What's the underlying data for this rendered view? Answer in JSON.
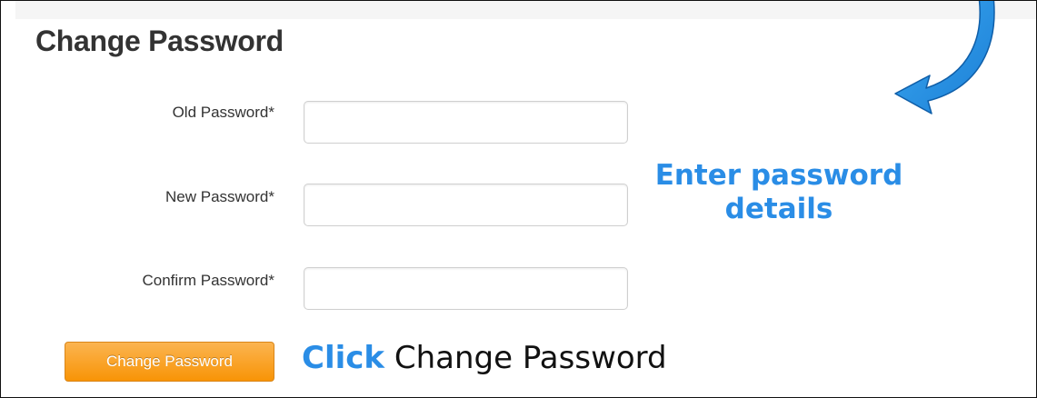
{
  "page": {
    "title": "Change Password"
  },
  "form": {
    "fields": [
      {
        "label": "Old Password*",
        "value": "",
        "placeholder": ""
      },
      {
        "label": "New Password*",
        "value": "",
        "placeholder": ""
      },
      {
        "label": "Confirm Password*",
        "value": "",
        "placeholder": ""
      }
    ],
    "submit_label": "Change Password"
  },
  "annotations": {
    "enter_details": "Enter password details",
    "click_verb": "Click",
    "click_target": "Change Password",
    "arrow_icon": "curved-arrow-icon"
  },
  "colors": {
    "annotation_blue": "#2a8de6",
    "button_orange": "#f89406",
    "title_text": "#333333"
  }
}
